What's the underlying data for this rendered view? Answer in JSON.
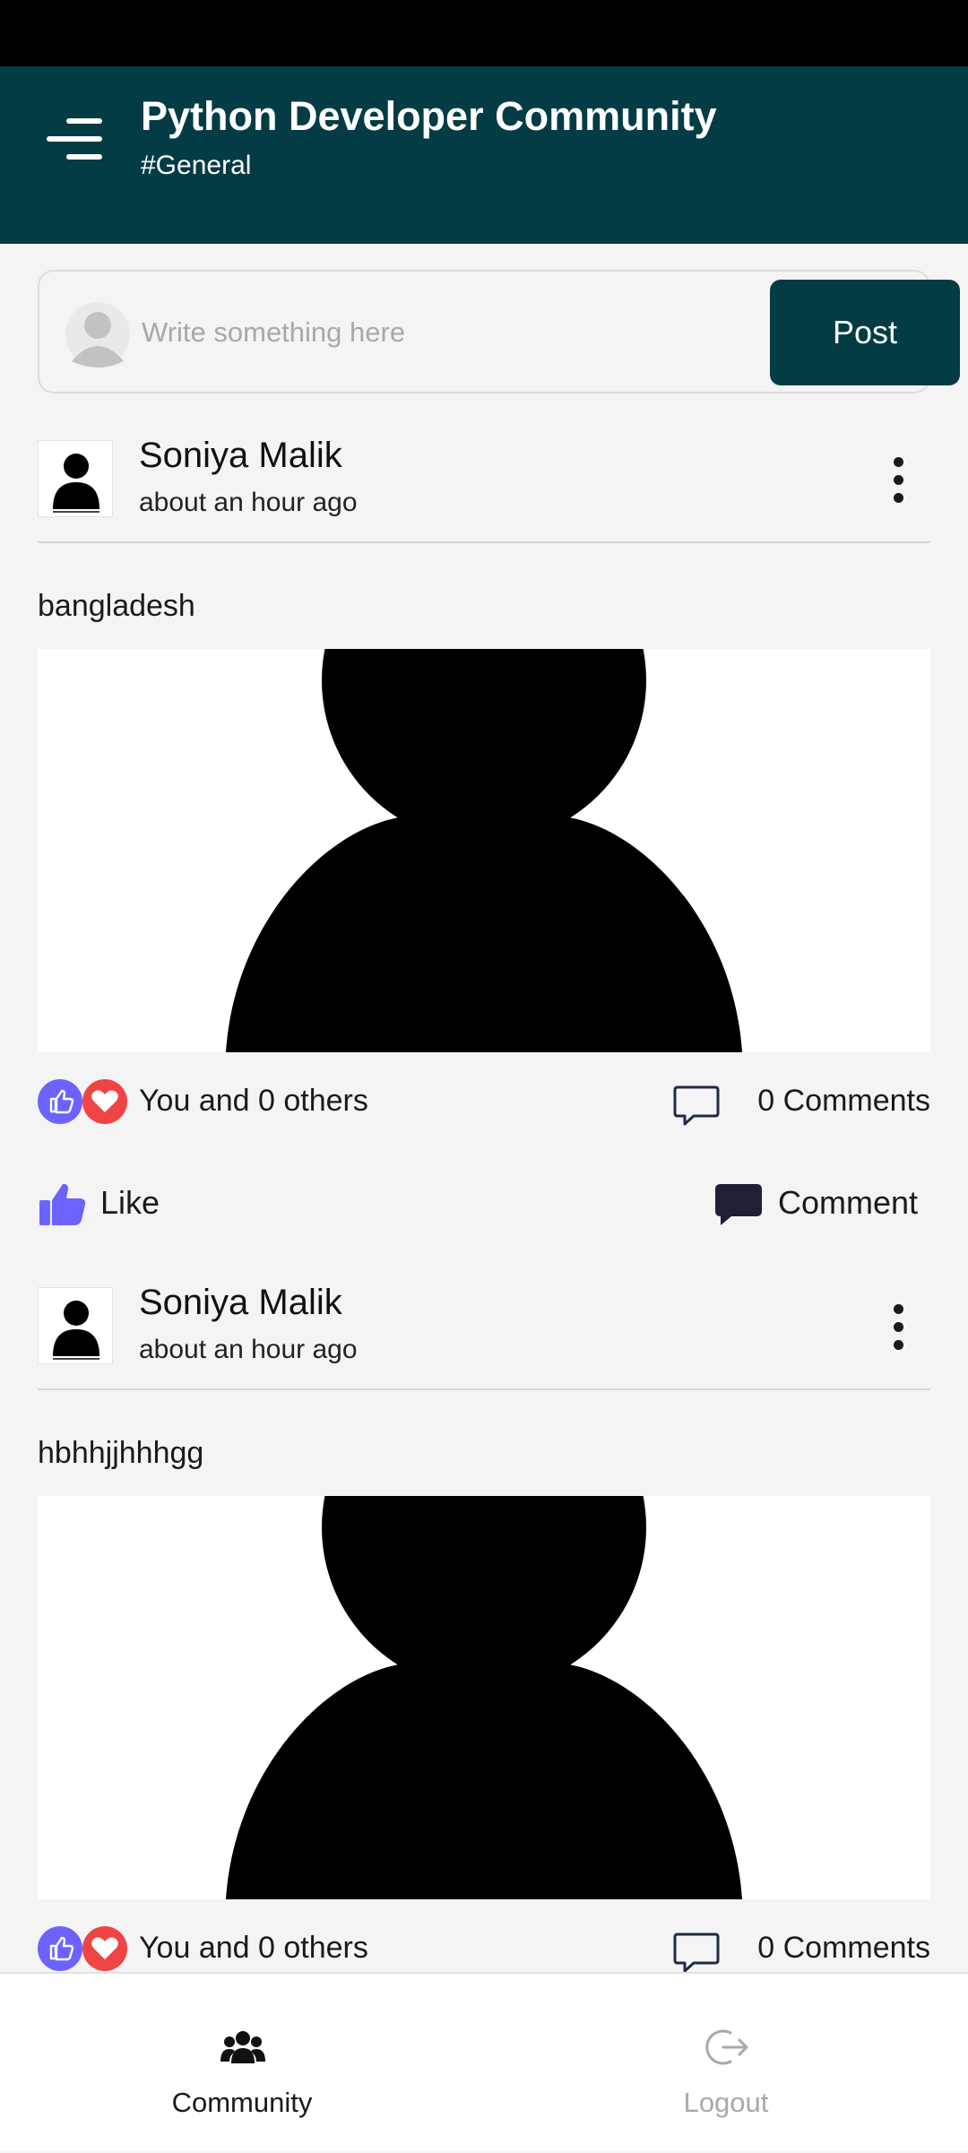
{
  "header": {
    "title": "Python Developer Community",
    "subtitle": "#General"
  },
  "composer": {
    "placeholder": "Write something here",
    "post_label": "Post"
  },
  "posts": [
    {
      "author": "Soniya Malik",
      "time": "about an hour ago",
      "text": "bangladesh",
      "likes_text": "You and 0 others",
      "comments_text": "0 Comments",
      "like_label": "Like",
      "comment_label": "Comment"
    },
    {
      "author": "Soniya Malik",
      "time": "about an hour ago",
      "text": "hbhhjjhhhgg",
      "likes_text": "You and 0 others",
      "comments_text": "0 Comments"
    }
  ],
  "bottom_nav": {
    "items": [
      {
        "label": "Community",
        "icon": "community-icon",
        "active": true
      },
      {
        "label": "Logout",
        "icon": "logout-icon",
        "active": false
      }
    ]
  },
  "colors": {
    "brand": "#033c44",
    "like": "#6c63ff",
    "heart": "#ef4444",
    "inactive": "#a9a9a9"
  }
}
